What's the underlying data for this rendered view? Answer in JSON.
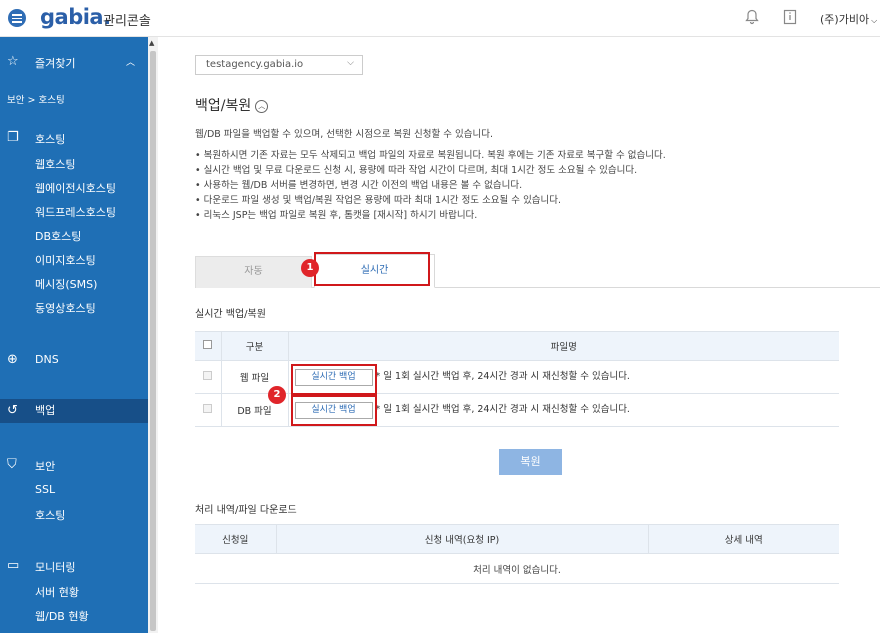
{
  "app": {
    "logo": "gabia.",
    "console": "관리콘솔",
    "user": "(주)가비아"
  },
  "sidebar": {
    "favorites": "즐겨찾기",
    "breadcrumb": "보안 > 호스팅",
    "groups": [
      {
        "label": "호스팅",
        "items": [
          "웹호스팅",
          "웹에이전시호스팅",
          "워드프레스호스팅",
          "DB호스팅",
          "이미지호스팅",
          "메시징(SMS)",
          "동영상호스팅"
        ]
      },
      {
        "label": "DNS",
        "items": []
      },
      {
        "label": "백업",
        "items": []
      },
      {
        "label": "보안",
        "items": [
          "SSL",
          "호스팅"
        ]
      },
      {
        "label": "모니터링",
        "items": [
          "서버 현황",
          "웹/DB 현황"
        ]
      }
    ]
  },
  "main": {
    "domain_select": "testagency.gabia.io",
    "title": "백업/복원",
    "description": "웹/DB 파일을 백업할 수 있으며, 선택한 시점으로 복원 신청할 수 있습니다.",
    "bullets": [
      "복원하시면 기존 자료는 모두 삭제되고 백업 파일의 자료로 복원됩니다. 복원 후에는 기존 자료로 복구할 수 없습니다.",
      "실시간 백업 및 무료 다운로드 신청 시, 용량에 따라 작업 시간이 다르며, 최대 1시간 정도 소요될 수 있습니다.",
      "사용하는 웹/DB 서버를 변경하면, 변경 시간 이전의 백업 내용은 볼 수 없습니다.",
      "다운로드 파일 생성 및 백업/복원 작업은 용량에 따라 최대 1시간 정도 소요될 수 있습니다.",
      "리눅스 JSP는 백업 파일로 복원 후, 톰캣을 [재시작] 하시기 바랍니다."
    ],
    "tabs": {
      "auto": "자동",
      "realtime": "실시간"
    },
    "badges": {
      "one": "1",
      "two": "2"
    },
    "realtime_section": "실시간 백업/복원",
    "backup_table": {
      "headers": {
        "type": "구분",
        "filename": "파일명"
      },
      "rows": [
        {
          "type": "웹 파일",
          "button": "실시간 백업",
          "note": "* 일 1회 실시간 백업 후, 24시간 경과 시 재신청할 수 있습니다."
        },
        {
          "type": "DB 파일",
          "button": "실시간 백업",
          "note": "* 일 1회 실시간 백업 후, 24시간 경과 시 재신청할 수 있습니다."
        }
      ]
    },
    "restore_button": "복원",
    "history_section": "처리 내역/파일 다운로드",
    "history_table": {
      "headers": {
        "date": "신청일",
        "detail": "신청 내역(요청 IP)",
        "more": "상세 내역"
      },
      "empty": "처리 내역이 없습니다."
    }
  }
}
